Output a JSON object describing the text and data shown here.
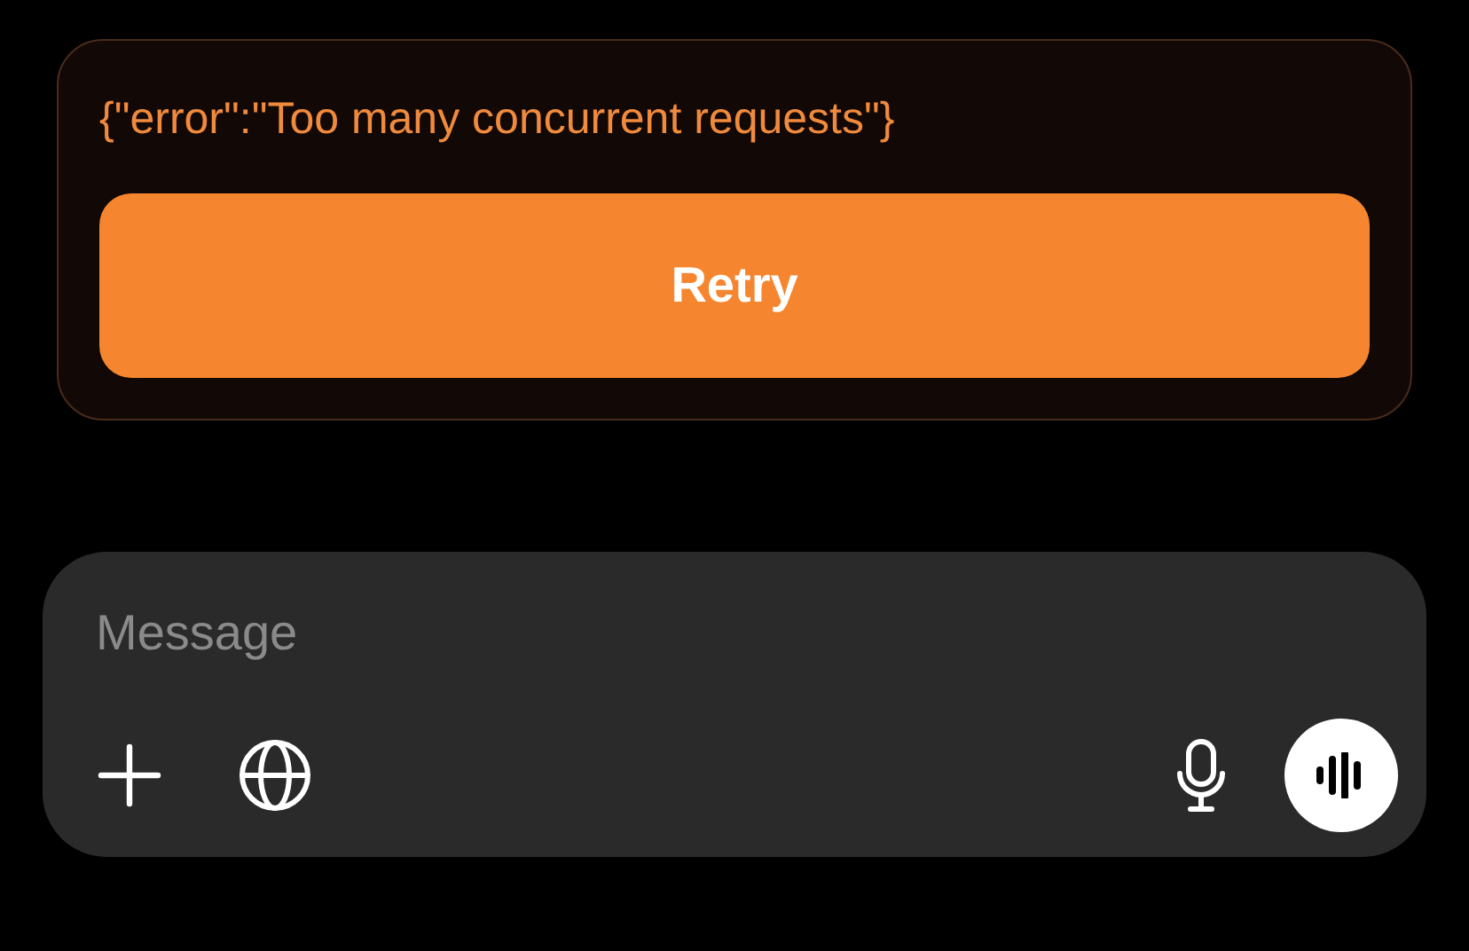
{
  "error_card": {
    "message": "{\"error\":\"Too many concurrent requests\"}",
    "retry_button": "Retry"
  },
  "composer": {
    "placeholder": "Message"
  }
}
